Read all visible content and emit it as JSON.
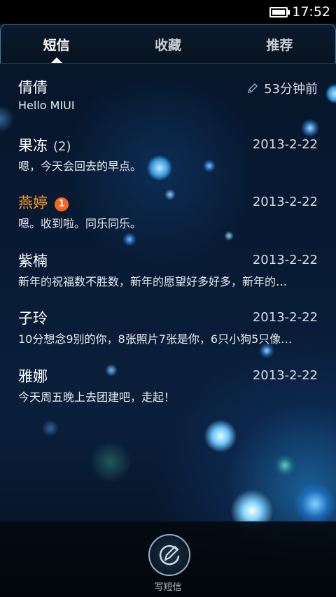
{
  "status_bar": {
    "time": "17:52",
    "battery_icon": "battery-full-icon"
  },
  "tabs": [
    {
      "label": "短信",
      "active": true
    },
    {
      "label": "收藏",
      "active": false
    },
    {
      "label": "推荐",
      "active": false
    }
  ],
  "conversations": [
    {
      "name": "倩倩",
      "count": "",
      "badge": "",
      "time": "53分钟前",
      "draft": true,
      "preview": "Hello MIUI"
    },
    {
      "name": "果冻",
      "count": "(2)",
      "badge": "",
      "time": "2013-2-22",
      "draft": false,
      "preview": "嗯，今天会回去的早点。"
    },
    {
      "name": "燕婷",
      "count": "",
      "badge": "1",
      "time": "2013-2-22",
      "draft": false,
      "preview": "嗯。收到啦。同乐同乐。"
    },
    {
      "name": "紫楠",
      "count": "",
      "badge": "",
      "time": "2013-2-22",
      "draft": false,
      "preview": "新年的祝福数不胜数，新年的愿望好多好多，新年的…"
    },
    {
      "name": "子玲",
      "count": "",
      "badge": "",
      "time": "2013-2-22",
      "draft": false,
      "preview": "10分想念9别的你，8张照片7张是你，6只小狗5只像…"
    },
    {
      "name": "雅娜",
      "count": "",
      "badge": "",
      "time": "2013-2-22",
      "draft": false,
      "preview": "今天周五晚上去团建吧，走起！"
    }
  ],
  "bottom_bar": {
    "compose_label": "写短信",
    "compose_icon": "compose-message-icon"
  },
  "colors": {
    "unread_name": "#ff9a2b",
    "badge": "#f5651d",
    "tab_border": "#3d7ea3"
  }
}
